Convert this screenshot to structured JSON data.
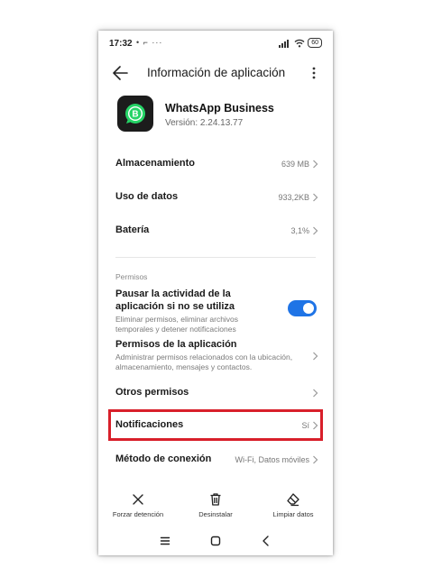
{
  "status_bar": {
    "time": "17:32",
    "left_icons": "• ⌐ ···",
    "battery": "60"
  },
  "app_bar": {
    "title": "Información de aplicación",
    "back_icon": "arrow-left-icon",
    "more_icon": "more-vertical-icon"
  },
  "app": {
    "name": "WhatsApp Business",
    "version": "Versión: 2.24.13.77",
    "icon": "whatsapp-business-logo",
    "brand_color": "#25d366"
  },
  "rows": {
    "storage": {
      "label": "Almacenamiento",
      "value": "639 MB"
    },
    "data_usage": {
      "label": "Uso de datos",
      "value": "933,2KB"
    },
    "battery": {
      "label": "Batería",
      "value": "3,1%"
    }
  },
  "permissions": {
    "section_label": "Permisos",
    "pause_activity": {
      "label_line1": "Pausar la actividad de la",
      "label_line2": "aplicación si no se utiliza",
      "desc_line1": "Eliminar permisos, eliminar archivos",
      "desc_line2": "temporales y detener notificaciones",
      "enabled": true,
      "toggle_color": "#1f74e6"
    },
    "app_permissions": {
      "label": "Permisos de la aplicación",
      "desc_line1": "Administrar permisos relacionados con la ubicación,",
      "desc_line2": "almacenamiento, mensajes y contactos."
    },
    "other_permissions": {
      "label": "Otros permisos"
    }
  },
  "notifications": {
    "label": "Notificaciones",
    "value": "Sí",
    "highlight_color": "#d81f2a"
  },
  "connection": {
    "label": "Método de conexión",
    "value": "Wi-Fi, Datos móviles"
  },
  "actions": {
    "force_stop": {
      "label": "Forzar detención",
      "icon": "close-icon"
    },
    "uninstall": {
      "label": "Desinstalar",
      "icon": "trash-icon"
    },
    "clear_data": {
      "label": "Limpiar datos",
      "icon": "eraser-icon"
    }
  },
  "nav_bar": {
    "menu_icon": "menu-icon",
    "home_icon": "home-square-icon",
    "back_icon": "back-chevron-icon"
  }
}
